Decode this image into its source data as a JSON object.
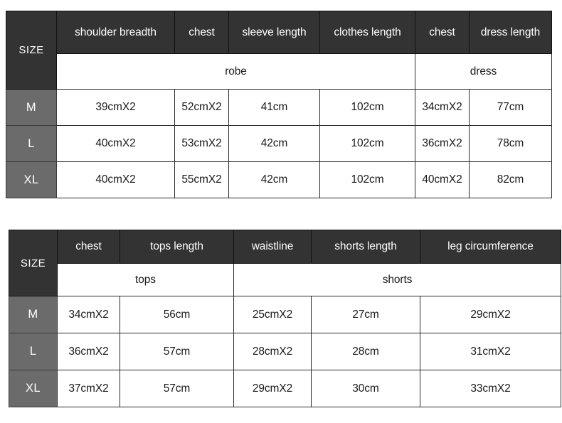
{
  "tables": [
    {
      "id": "robe-dress",
      "size_label": "SIZE",
      "columns": [
        "shoulder breadth",
        "chest",
        "sleeve length",
        "clothes length",
        "chest",
        "dress length"
      ],
      "groups": [
        {
          "label": "robe",
          "span": 4
        },
        {
          "label": "dress",
          "span": 2
        }
      ],
      "rows": [
        {
          "size": "M",
          "values": [
            "39cmX2",
            "52cmX2",
            "41cm",
            "102cm",
            "34cmX2",
            "77cm"
          ]
        },
        {
          "size": "L",
          "values": [
            "40cmX2",
            "53cmX2",
            "42cm",
            "102cm",
            "36cmX2",
            "78cm"
          ]
        },
        {
          "size": "XL",
          "values": [
            "40cmX2",
            "55cmX2",
            "42cm",
            "102cm",
            "40cmX2",
            "82cm"
          ]
        }
      ]
    },
    {
      "id": "tops-shorts",
      "size_label": "SIZE",
      "columns": [
        "chest",
        "tops length",
        "waistline",
        "shorts length",
        "leg circumference"
      ],
      "groups": [
        {
          "label": "tops",
          "span": 2
        },
        {
          "label": "shorts",
          "span": 3
        }
      ],
      "rows": [
        {
          "size": "M",
          "values": [
            "34cmX2",
            "56cm",
            "25cmX2",
            "27cm",
            "29cmX2"
          ]
        },
        {
          "size": "L",
          "values": [
            "36cmX2",
            "57cm",
            "28cmX2",
            "28cm",
            "31cmX2"
          ]
        },
        {
          "size": "XL",
          "values": [
            "37cmX2",
            "57cm",
            "29cmX2",
            "30cm",
            "33cmX2"
          ]
        }
      ]
    }
  ],
  "colors": {
    "header_dark": "#333333",
    "size_cell_gray": "#6b6b6b",
    "cell_background": "#ffffff",
    "text_light": "#ffffff",
    "text_dark": "#1a1a1a",
    "border": "#2b2b2b"
  }
}
